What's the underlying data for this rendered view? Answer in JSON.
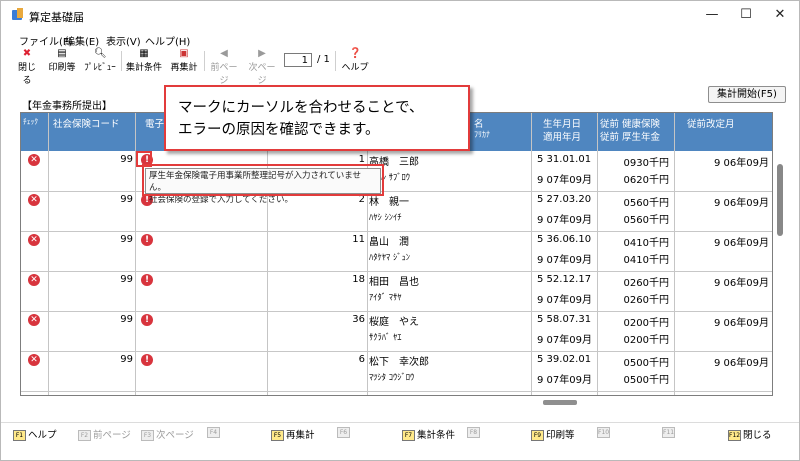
{
  "window": {
    "title": "算定基礎届",
    "controls": {
      "minimize": "—",
      "maximize": "☐",
      "close": "✕"
    }
  },
  "menu": [
    "ファイル(F)",
    "編集(E)",
    "表示(V)",
    "ヘルプ(H)"
  ],
  "toolbar": {
    "close": "閉じる",
    "print": "印刷等",
    "preview": "ﾌﾟﾚﾋﾞｭｰ",
    "conditions": "集計条件",
    "recount": "再集計",
    "prev_page": "前ページ",
    "next_page": "次ページ",
    "page_current": "1",
    "page_total": "/ 1",
    "help": "ヘルプ"
  },
  "section_title": "【年金事務所提出】",
  "start_button": "集計開始(F5)",
  "columns": {
    "check": "ﾁｪｯｸ",
    "insurance_code": "社会保険コード",
    "electronic_fragment": "電子",
    "name_fragment": "名",
    "name_kana_fragment": "ﾌﾘｶﾅ",
    "birth": "生年月日",
    "enroll": "適用年月",
    "prev_health": "従前 健康保険",
    "prev_pension": "従前 厚生年金",
    "revision_month": "従前改定月"
  },
  "rows": [
    {
      "code": "99",
      "seq": "1",
      "name": "高橋　三郎",
      "kana": "ﾀｶﾊｼ ｻﾌﾞﾛｳ",
      "birth": "5 31.01.01",
      "enroll": "9 07年09月",
      "health": "0930千円",
      "pension": "0620千円",
      "revision": "9 06年09月"
    },
    {
      "code": "99",
      "seq": "2",
      "name": "林　親一",
      "kana": "ﾊﾔｼ ｼﾝｲﾁ",
      "birth": "5 27.03.20",
      "enroll": "9 07年09月",
      "health": "0560千円",
      "pension": "0560千円",
      "revision": "9 06年09月"
    },
    {
      "code": "99",
      "seq": "11",
      "name": "畠山　潤",
      "kana": "ﾊﾀｹﾔﾏ ｼﾞｭﾝ",
      "birth": "5 36.06.10",
      "enroll": "9 07年09月",
      "health": "0410千円",
      "pension": "0410千円",
      "revision": "9 06年09月"
    },
    {
      "code": "99",
      "seq": "18",
      "name": "相田　昌也",
      "kana": "ｱｲﾀﾞ ﾏｻﾔ",
      "birth": "5 52.12.17",
      "enroll": "9 07年09月",
      "health": "0260千円",
      "pension": "0260千円",
      "revision": "9 06年09月"
    },
    {
      "code": "99",
      "seq": "36",
      "name": "桜庭　やえ",
      "kana": "ｻｸﾗﾊﾞ ﾔｴ",
      "birth": "5 58.07.31",
      "enroll": "9 07年09月",
      "health": "0200千円",
      "pension": "0200千円",
      "revision": "9 06年09月"
    },
    {
      "code": "99",
      "seq": "6",
      "name": "松下　幸次郎",
      "kana": "ﾏﾂｼﾀ ｺｳｼﾞﾛｳ",
      "birth": "5 39.02.01",
      "enroll": "9 07年09月",
      "health": "0500千円",
      "pension": "0500千円",
      "revision": "9 06年09月"
    }
  ],
  "tooltip": {
    "line1": "厚生年金保険電子用事業所整理記号が入力されていません。",
    "line2": "社会保険の登録で入力してください。"
  },
  "callout": {
    "line1": "マークにカーソルを合わせることで、",
    "line2": "エラーの原因を確認できます。"
  },
  "function_keys": [
    {
      "key": "F1",
      "label": "ヘルプ",
      "enabled": true
    },
    {
      "key": "F2",
      "label": "前ページ",
      "enabled": false
    },
    {
      "key": "F3",
      "label": "次ページ",
      "enabled": false
    },
    {
      "key": "F4",
      "label": "",
      "enabled": false
    },
    {
      "key": "F5",
      "label": "再集計",
      "enabled": true
    },
    {
      "key": "F6",
      "label": "",
      "enabled": false
    },
    {
      "key": "F7",
      "label": "集計条件",
      "enabled": true
    },
    {
      "key": "F8",
      "label": "",
      "enabled": false
    },
    {
      "key": "F9",
      "label": "印刷等",
      "enabled": true
    },
    {
      "key": "F10",
      "label": "",
      "enabled": false
    },
    {
      "key": "F11",
      "label": "",
      "enabled": false
    },
    {
      "key": "F12",
      "label": "閉じる",
      "enabled": true
    }
  ],
  "colors": {
    "header_blue": "#4f86c0",
    "error_red": "#d8343d",
    "highlight_red": "#e23b3b"
  }
}
